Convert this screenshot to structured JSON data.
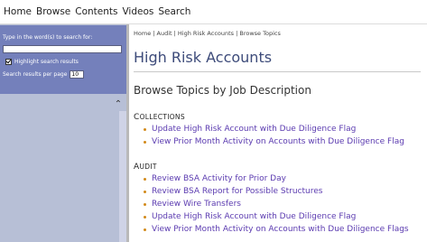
{
  "menu": {
    "items": [
      "Home",
      "Browse",
      "Contents",
      "Videos",
      "Search"
    ]
  },
  "search": {
    "label": "Type in the word(s) to search for:",
    "highlight_label": "Highlight search results",
    "per_page_label": "Search results per page",
    "per_page_value": "10"
  },
  "breadcrumb": "Home | Audit | High Risk Accounts | Browse Topics",
  "page_title": "High Risk Accounts",
  "subtitle": "Browse Topics by Job Description",
  "sections": [
    {
      "cap": "C",
      "rest": "OLLECTIONS",
      "items": [
        "Update High Risk Account with Due Diligence Flag",
        "View Prior Month Activity on Accounts with Due Diligence Flag"
      ]
    },
    {
      "cap": "A",
      "rest": "UDIT",
      "items": [
        "Review BSA Activity for Prior Day",
        "Review BSA Report for Possible Structures",
        "Review Wire Transfers",
        "Update High Risk Account with Due Diligence Flag",
        "View Prior Month Activity on Accounts with Due Diligence Flags"
      ]
    }
  ]
}
